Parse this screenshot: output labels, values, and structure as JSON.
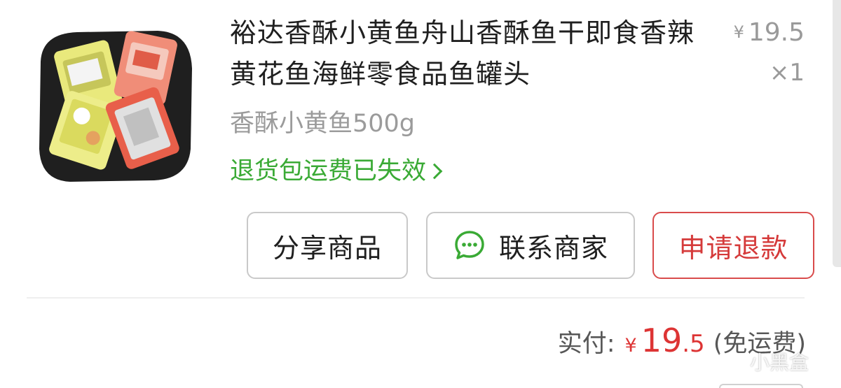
{
  "product": {
    "title": "裕达香酥小黄鱼舟山香酥鱼干即食香辣黄花鱼海鲜零食品鱼罐头",
    "price_currency": "¥",
    "price_value": "19.5",
    "quantity": "×1",
    "spec": "香酥小黄鱼500g",
    "return_notice": "退货包运费已失效"
  },
  "actions": {
    "share_label": "分享商品",
    "contact_label": "联系商家",
    "refund_label": "申请退款"
  },
  "summary": {
    "paid_label": "实付:",
    "paid_currency": "¥",
    "paid_integer": "19",
    "paid_decimal": ".5",
    "shipping_note": "(免运费)"
  },
  "watermark": {
    "text": "小黑盒"
  },
  "icons": {
    "chat": "wechat-bubble-icon",
    "chevron": "chevron-right-icon"
  },
  "colors": {
    "green_accent": "#3aaa35",
    "red_accent": "#dd3434",
    "muted_text": "#9a9a9a"
  }
}
